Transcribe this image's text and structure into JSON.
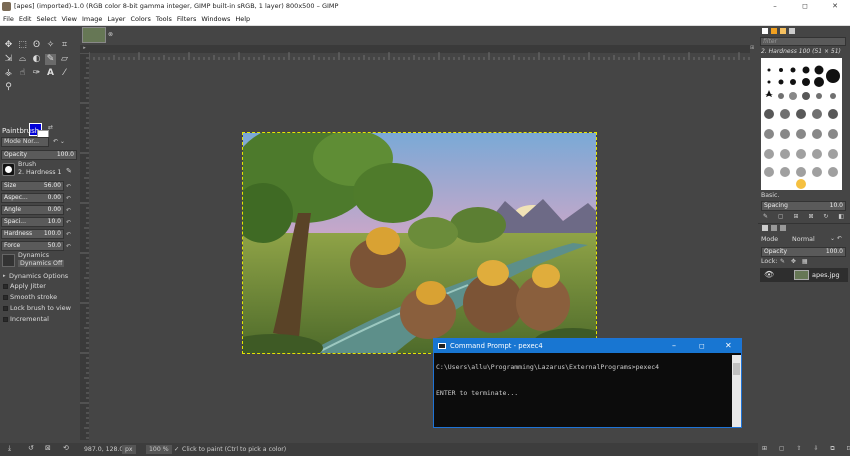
{
  "window": {
    "title": "[apes] (imported)-1.0 (RGB color 8-bit gamma integer, GIMP built-in sRGB, 1 layer) 800x500 – GIMP",
    "controls": [
      "–",
      "◻",
      "✕"
    ]
  },
  "menubar": [
    "File",
    "Edit",
    "Select",
    "View",
    "Image",
    "Layer",
    "Colors",
    "Tools",
    "Filters",
    "Windows",
    "Help"
  ],
  "tool_options": {
    "title": "Paintbrush",
    "mode": "Mode Nor...",
    "opacity_label": "Opacity",
    "opacity_value": "100.0",
    "brush_label": "Brush",
    "brush_name": "2. Hardness 1",
    "sliders": [
      {
        "label": "Size",
        "value": "56.00"
      },
      {
        "label": "Aspec...",
        "value": "0.00"
      },
      {
        "label": "Angle",
        "value": "0.00"
      },
      {
        "label": "Spaci...",
        "value": "10.0"
      },
      {
        "label": "Hardness",
        "value": "100.0"
      },
      {
        "label": "Force",
        "value": "50.0"
      }
    ],
    "dynamics_label": "Dynamics",
    "dynamics_value": "Dynamics Off",
    "options": [
      "Dynamics Options",
      "Apply Jitter",
      "Smooth stroke",
      "Lock brush to view",
      "Incremental"
    ]
  },
  "brushes": {
    "filter_placeholder": "filter",
    "current": "2. Hardness 100 (51 × 51)",
    "preset": "Basic.",
    "spacing_label": "Spacing",
    "spacing_value": "10.0"
  },
  "layers": {
    "mode_label": "Mode",
    "mode_value": "Normal",
    "opacity_label": "Opacity",
    "opacity_value": "100.0",
    "lock_label": "Lock:",
    "layer_name": "apes.jpg"
  },
  "statusbar": {
    "coords": "987.0, 128.0",
    "unit": "px",
    "zoom": "100 %",
    "message": "Click to paint (Ctrl to pick a color)"
  },
  "command_prompt": {
    "title": "Command Prompt - pexec4",
    "line1": "C:\\Users\\allu\\Programming\\Lazarus\\ExternalPrograms>pexec4",
    "line2": "ENTER to terminate..."
  },
  "colors": {
    "foreground": "#0000d8",
    "background": "#ffffff",
    "canvas_border": "#e6e600",
    "cmd_titlebar": "#1876d2"
  }
}
